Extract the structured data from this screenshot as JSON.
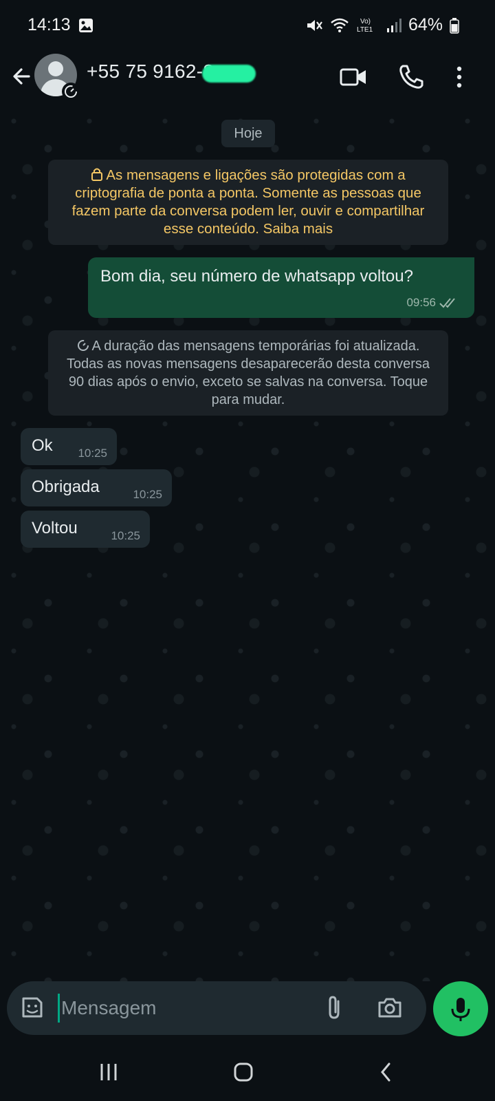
{
  "status_bar": {
    "time": "14:13",
    "battery": "64%",
    "icons": [
      "gallery-icon",
      "mute-icon",
      "wifi-icon",
      "volte-lte-icon",
      "signal-icon",
      "battery-icon"
    ]
  },
  "header": {
    "contact": "+55 75 9162-8",
    "icons": [
      "back-arrow-icon",
      "avatar",
      "disappearing-timer-icon",
      "video-call-icon",
      "voice-call-icon",
      "more-options-icon"
    ]
  },
  "chat": {
    "date_label": "Hoje",
    "encryption_notice": "As mensagens e ligações são protegidas com a criptografia de ponta a ponta. Somente as pessoas que fazem parte da conversa podem ler, ouvir e compartilhar esse conteúdo. Saiba mais",
    "outgoing": [
      {
        "text": "Bom dia, seu número de whatsapp voltou?",
        "time": "09:56"
      }
    ],
    "system_notice": "A duração das mensagens temporárias foi atualizada. Todas as novas mensagens desaparecerão desta conversa 90 dias após o envio, exceto se salvas na conversa. Toque para mudar.",
    "incoming": [
      {
        "text": "Ok",
        "time": "10:25"
      },
      {
        "text": "Obrigada",
        "time": "10:25"
      },
      {
        "text": "Voltou",
        "time": "10:25"
      }
    ]
  },
  "composer": {
    "placeholder": "Mensagem",
    "icons": [
      "sticker-icon",
      "attach-icon",
      "camera-icon",
      "mic-icon"
    ]
  },
  "navbar": {
    "icons": [
      "recent-apps-icon",
      "home-icon",
      "back-icon"
    ]
  },
  "colors": {
    "background": "#0b1014",
    "outgoing_bubble": "#144d37",
    "incoming_bubble": "#1f2a30",
    "notice_text": "#f4c765",
    "accent": "#21c063"
  }
}
